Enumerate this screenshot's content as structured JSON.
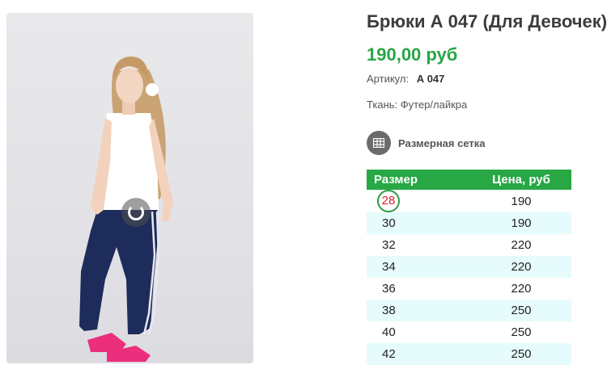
{
  "product": {
    "title": "Брюки А 047 (Для Девочек)",
    "price": "190,00 руб",
    "sku_label": "Артикул:",
    "sku_value": "А 047",
    "fabric": "Ткань: Футер/лайкра",
    "size_chart_label": "Размерная сетка"
  },
  "size_table": {
    "headers": [
      "Размер",
      "Цена, руб"
    ],
    "rows": [
      {
        "size": "28",
        "price": "190"
      },
      {
        "size": "30",
        "price": "190"
      },
      {
        "size": "32",
        "price": "220"
      },
      {
        "size": "34",
        "price": "220"
      },
      {
        "size": "36",
        "price": "220"
      },
      {
        "size": "38",
        "price": "250"
      },
      {
        "size": "40",
        "price": "250"
      },
      {
        "size": "42",
        "price": "250"
      }
    ],
    "selected_size": "28"
  },
  "colors": {
    "accent_green": "#28a745",
    "price_green": "#27a645",
    "row_alt": "#e6fbfc",
    "selected_text": "#d81f26"
  },
  "icons": {
    "loader": "loading-spinner-icon",
    "size_chart": "table-grid-icon"
  }
}
